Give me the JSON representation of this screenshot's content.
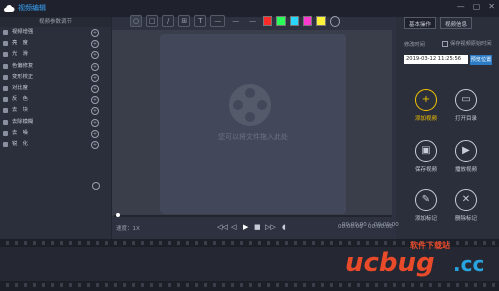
{
  "app": {
    "title": "视频编辑"
  },
  "left_panel": {
    "header": "视频参数调节",
    "items": [
      {
        "label": "视频增强",
        "icon": "video-enhance-icon"
      },
      {
        "label": "亮　度",
        "icon": "brightness-icon"
      },
      {
        "label": "光　滑",
        "icon": "smooth-icon"
      },
      {
        "label": "色偏修复",
        "icon": "color-fix-icon"
      },
      {
        "label": "变形校正",
        "icon": "deform-icon"
      },
      {
        "label": "对比度",
        "icon": "contrast-icon"
      },
      {
        "label": "反　色",
        "icon": "invert-icon"
      },
      {
        "label": "去　块",
        "icon": "deblock-icon"
      },
      {
        "label": "去除模糊",
        "icon": "deblur-icon"
      },
      {
        "label": "去　噪",
        "icon": "denoise-icon"
      },
      {
        "label": "锐　化",
        "icon": "sharpen-icon"
      }
    ]
  },
  "toolbar": {
    "tools": [
      "○",
      "□",
      "/",
      "⊞",
      "T"
    ],
    "colors": [
      "#ff2a2a",
      "#2aff5a",
      "#2ad8ff",
      "#ff3ad1",
      "#fff23a"
    ]
  },
  "canvas": {
    "drop_text": "您可以将文件拖入此处"
  },
  "playback": {
    "speed": "速度：1X",
    "time_current": "00:00:00",
    "time_sep": "/",
    "time_total": "00:00:00",
    "time_right_current": "00:00:00",
    "time_right_total": "00:00:00",
    "progress": 0.0
  },
  "right_panel": {
    "tabs": [
      "基本操作",
      "视频信息"
    ],
    "date_label": "修改时间",
    "keep_label": "保存视频原始时间",
    "date_value": "2019-03-12  11:25:56",
    "date_button": "预览位置",
    "actions": [
      {
        "label": "添加视频",
        "icon": "plus-icon",
        "highlight": true
      },
      {
        "label": "打开目录",
        "icon": "folder-icon",
        "highlight": false
      },
      {
        "label": "保存视频",
        "icon": "save-icon",
        "highlight": false
      },
      {
        "label": "播放视频",
        "icon": "play-video-icon",
        "highlight": false
      },
      {
        "label": "添加标记",
        "icon": "add-mark-icon",
        "highlight": false
      },
      {
        "label": "删除标记",
        "icon": "delete-mark-icon",
        "highlight": false
      }
    ]
  },
  "watermark": {
    "line1": "软件下载站",
    "brand": "ucbug",
    "dot": ".cc"
  }
}
